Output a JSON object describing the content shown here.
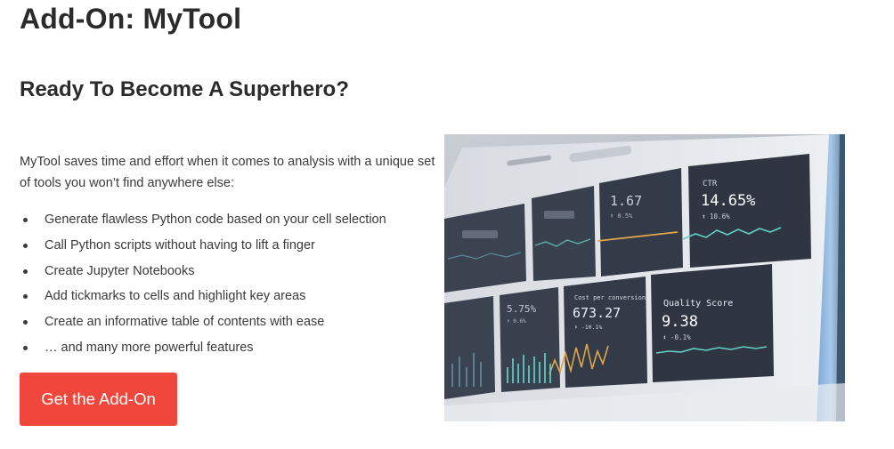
{
  "page": {
    "title": "Add-On: MyTool",
    "heading": "Ready To Become A Superhero?",
    "intro": "MyTool saves time and effort when it comes to analysis with a unique set of tools you won’t find anywhere else:"
  },
  "features": [
    "Generate flawless Python code based on your cell selection",
    "Call Python scripts without having to lift a finger",
    "Create Jupyter Notebooks",
    "Add tickmarks to cells and highlight key areas",
    "Create an informative table of contents with ease",
    "… and many more powerful features"
  ],
  "cta": {
    "label": "Get the Add-On"
  },
  "colors": {
    "accent": "#f0473c",
    "text": "#3a3a3a"
  },
  "image": {
    "panel_ctr": {
      "label": "CTR",
      "value": "14.65%",
      "delta": "⬆ 10.6%"
    },
    "panel_mid": {
      "value": "1.67",
      "delta": "⬆ 0.5%"
    },
    "panel_cost": {
      "label": "Cost per conversion",
      "value": "673.27",
      "delta": "⬇ -10.1%"
    },
    "panel_quality": {
      "label": "Quality Score",
      "value": "9.38",
      "delta": "⬇ -0.1%"
    },
    "panel_small": {
      "value": "5.75%",
      "delta": "⬆ 0.6%"
    }
  }
}
